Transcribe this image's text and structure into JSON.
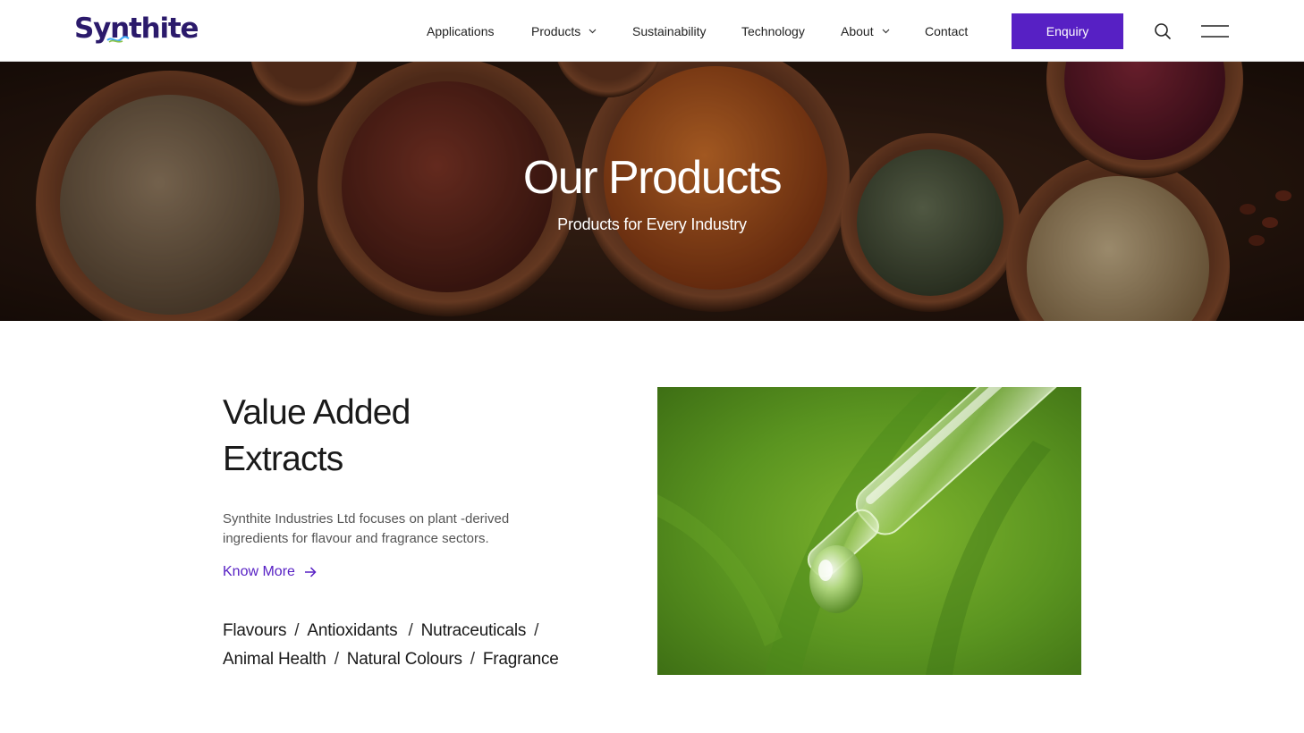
{
  "header": {
    "logo_text": "Synthite",
    "nav": [
      {
        "label": "Applications",
        "has_dropdown": false
      },
      {
        "label": "Products",
        "has_dropdown": true
      },
      {
        "label": "Sustainability",
        "has_dropdown": false
      },
      {
        "label": "Technology",
        "has_dropdown": false
      },
      {
        "label": "About",
        "has_dropdown": true
      },
      {
        "label": "Contact",
        "has_dropdown": false
      }
    ],
    "enquiry_label": "Enquiry",
    "icons": [
      "search-icon",
      "hamburger-menu-icon",
      "chevron-down-icon"
    ]
  },
  "hero": {
    "title": "Our Products",
    "subtitle": "Products for Every Industry"
  },
  "section": {
    "title_line1": "Value Added",
    "title_line2": "Extracts",
    "description": "Synthite Industries Ltd focuses on plant -derived ingredients for flavour and fragrance sectors.",
    "link_label": "Know More",
    "tags": [
      "Flavours",
      "Antioxidants",
      "Nutraceuticals",
      "Animal Health",
      "Natural Colours",
      "Fragrance"
    ],
    "separator": "/"
  },
  "colors": {
    "brand_purple": "#5720c4",
    "logo_navy": "#2b1a6b",
    "text_dark": "#1a1a1a",
    "text_muted": "#555555"
  }
}
